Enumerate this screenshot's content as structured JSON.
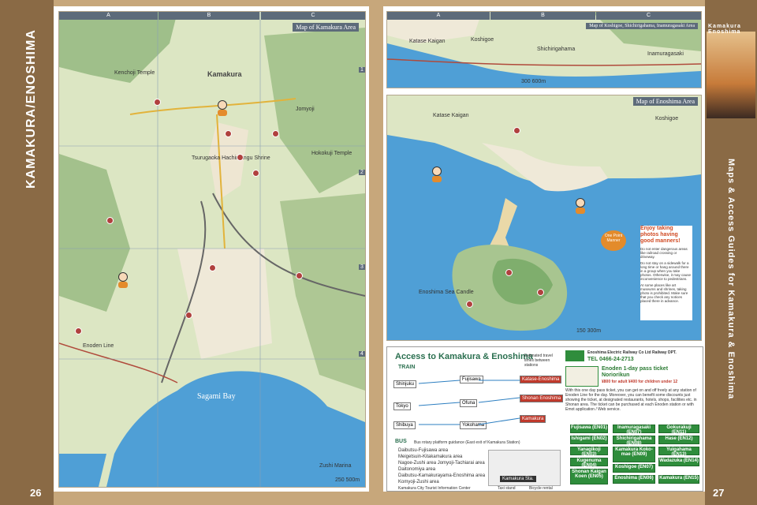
{
  "left_page": {
    "side_title": "KAMAKURA/ENOSHIMA",
    "page_number": "26",
    "map_title": "Map of Kamakura Area",
    "grid_cols": [
      "A",
      "B",
      "C"
    ],
    "grid_rows": [
      "1",
      "2",
      "3",
      "4"
    ],
    "labels": {
      "town": "Kamakura",
      "bay": "Sagami Bay",
      "zushi": "Zushi Marina",
      "jomyoji": "Jomyoji",
      "temple1": "Kenchoji Temple",
      "temple2": "Hokokuji Temple",
      "shrine": "Tsurugaoka Hachimangu Shrine",
      "enoden": "Enoden Line",
      "scale": "250  500m"
    }
  },
  "right_page": {
    "side_title_small": "Kamakura Enoshima",
    "side_title": "Maps & Access Guides for Kamakura & Enoshima",
    "page_number": "27",
    "map1_title": "Map of Koshigoe, Shichirigahama, Inamuragasaki Area",
    "map1_labels": {
      "katase": "Katase Kaigan",
      "koshigoe": "Koshigoe",
      "shichiri": "Shichirigahama",
      "inamura": "Inamuragasaki",
      "scale": "300  600m"
    },
    "map2_title": "Map of Enoshima Area",
    "map2_labels": {
      "katase": "Katase Kaigan",
      "koshigoe": "Koshigoe",
      "candle": "Enoshima Sea Candle",
      "scale": "150  300m"
    },
    "manners": {
      "badge": "One Point Manner",
      "title": "Enjoy taking photos having good manners!",
      "items": [
        "Do not enter dangerous areas like railroad crossing or driveway.",
        "Do not stay on a sidewalk for a long time or hang around there in a group when you take photos. Otherwise, it may cause inconvenience to pedestrians.",
        "At some places like art museums and shrines, taking photo is prohibited. Make sure that you check any notices placed there in advance."
      ]
    },
    "access": {
      "title": "Access to Kamakura & Enoshima",
      "subtitle": "Estimated travel times between stations",
      "train_label": "TRAIN",
      "stations": [
        "Shinjuku",
        "Tokyo",
        "Shibuya",
        "Fujisawa",
        "Ofuna",
        "Yokohama"
      ],
      "destinations": [
        "Katase-Enoshima",
        "Shonan Enoshima",
        "Kamakura"
      ],
      "bus_label": "BUS",
      "bus_note": "Bus rotary platform guidance (East exit of Kamakura Station)",
      "bus_routes": [
        "Daibutsu-Fujisawa area",
        "Meigetsuin-Kitakamakura area",
        "Nagoe-Zushi area  Jomyoji-Tachiarai area",
        "Daitonomiya area",
        "Daibutsu-Kamakurayama-Enoshima area",
        "Komyoji-Zushi area"
      ],
      "info_center": "Kamakura City Tourist Information Center",
      "taxi": "Taxi stand",
      "bicycle": "Bicycle rental",
      "kamakura_sta": "Kamakura Sta."
    },
    "enoden": {
      "company": "Enoshima Electric Railway Co Ltd Railway DPT.",
      "tel": "TEL 0466-24-2713",
      "pass_title": "Enoden 1-day pass ticket",
      "pass_name": "Noriorikun",
      "price": "¥800 for adult  ¥400 for children under 12",
      "description": "With this one day pass ticket, you can get on and off freely at any station of Enoden Line for the day. Moreover, you can benefit some discounts just showing the ticket, at designated restaurants, hotels, shops, facilities etc. in Shonan area. The ticket can be purchased at each Enoden station or with Emot application / Web service.",
      "stations": [
        "Fujisawa (EN01)",
        "Ishigami (EN02)",
        "Yanagikoji (EN03)",
        "Kugenuma (EN04)",
        "Shonan Kaigan Koen (EN05)",
        "Inamuragasaki (EN07)",
        "Shichirigahama (EN08)",
        "Kamakura Koko-mae (EN09)",
        "Koshigoe (EN07)",
        "Enoshima (EN06)",
        "Gokurakuji (EN11)",
        "Hase (EN12)",
        "Yuigahama (EN13)",
        "Wadazuka (EN14)",
        "Kamakura (EN15)"
      ]
    }
  }
}
